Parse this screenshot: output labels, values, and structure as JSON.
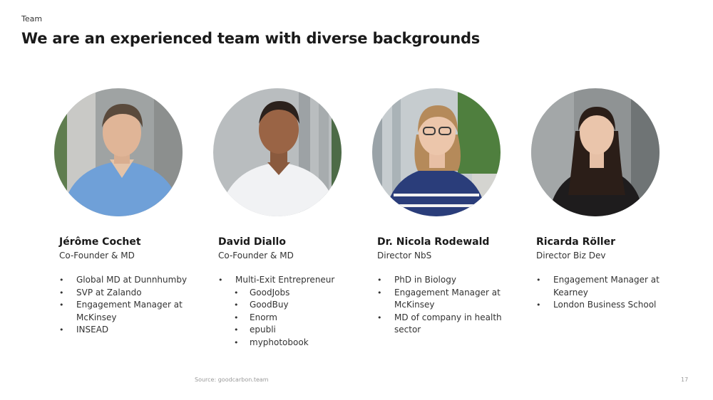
{
  "slide": {
    "section_label": "Team",
    "headline": "We are an experienced team with diverse backgrounds",
    "source": "Source: goodcarbon.team",
    "page_number": "17"
  },
  "members": [
    {
      "name": "Jérôme Cochet",
      "role": "Co-Founder & MD",
      "bullets": [
        "Global MD at Dunnhumby",
        "SVP at Zalando",
        "Engagement Manager at McKinsey",
        "INSEAD"
      ]
    },
    {
      "name": "David Diallo",
      "role": "Co-Founder & MD",
      "bullets": [
        "Multi-Exit Entrepreneur",
        "GoodJobs",
        "GoodBuy",
        "Enorm",
        "epubli",
        "myphotobook"
      ]
    },
    {
      "name": "Dr. Nicola Rodewald",
      "role": "Director NbS",
      "bullets": [
        "PhD in Biology",
        "Engagement Manager at McKinsey",
        "MD of company in health sector"
      ]
    },
    {
      "name": "Ricarda Röller",
      "role": "Director Biz Dev",
      "bullets": [
        "Engagement Manager at Kearney",
        "London Business School"
      ]
    }
  ]
}
